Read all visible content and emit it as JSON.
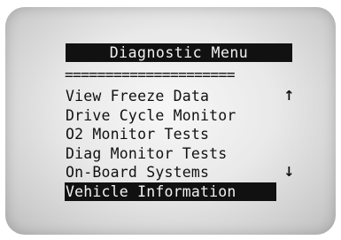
{
  "menu": {
    "title": "Diagnostic Menu",
    "separator": "=====================",
    "items": [
      {
        "label": "View Freeze Data",
        "arrow": "↑",
        "selected": false
      },
      {
        "label": "Drive Cycle Monitor",
        "arrow": "",
        "selected": false
      },
      {
        "label": "O2 Monitor Tests",
        "arrow": "",
        "selected": false
      },
      {
        "label": "Diag Monitor Tests",
        "arrow": "",
        "selected": false
      },
      {
        "label": "On-Board Systems",
        "arrow": "↓",
        "selected": false
      },
      {
        "label": "Vehicle Information",
        "arrow": "",
        "selected": true
      }
    ]
  },
  "icons": {
    "scroll_up": "up-arrow-icon",
    "scroll_down": "down-arrow-icon"
  },
  "colors": {
    "lcd_text": "#111111",
    "highlight_bg": "#111111",
    "highlight_text": "#f2f2f2"
  }
}
